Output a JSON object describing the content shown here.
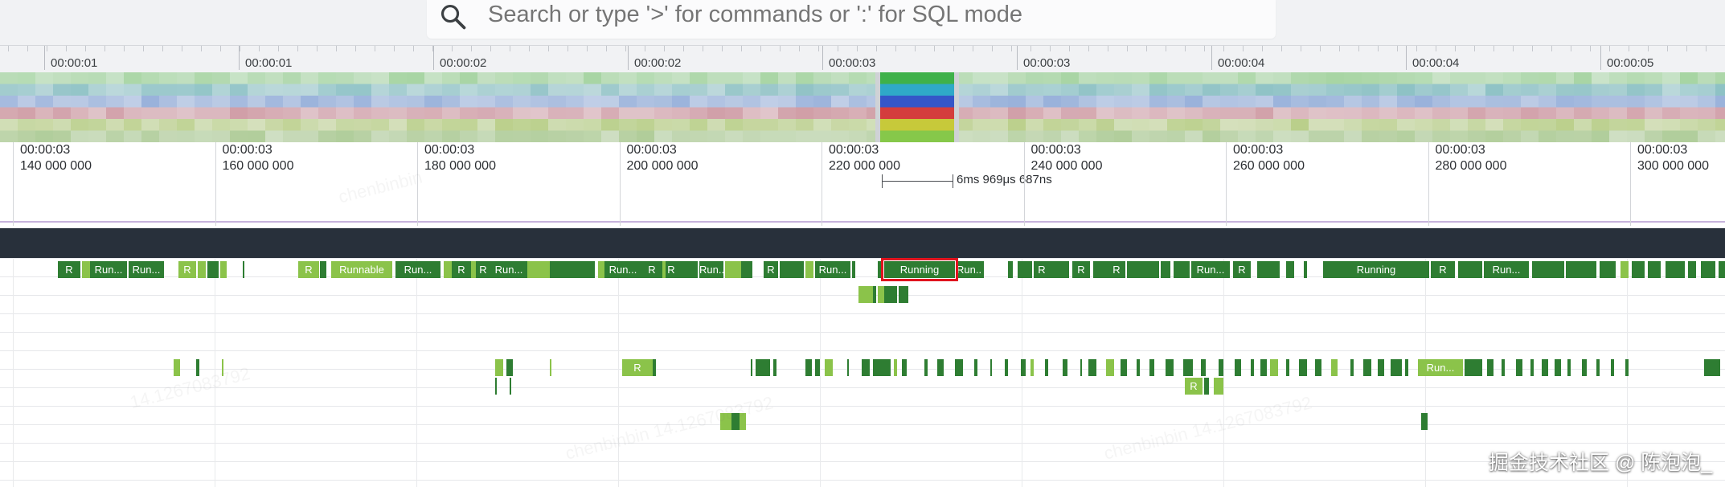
{
  "search": {
    "placeholder": "Search or type '>' for commands or ':' for SQL mode",
    "icon": "search-icon"
  },
  "top_ruler": {
    "labels": [
      "00:00:01",
      "00:00:01",
      "00:00:02",
      "00:00:02",
      "00:00:03",
      "00:00:03",
      "00:00:04",
      "00:00:04",
      "00:00:05"
    ]
  },
  "detail_axis": {
    "labels": [
      {
        "time": "00:00:03",
        "ns": "140 000 000"
      },
      {
        "time": "00:00:03",
        "ns": "160 000 000"
      },
      {
        "time": "00:00:03",
        "ns": "180 000 000"
      },
      {
        "time": "00:00:03",
        "ns": "200 000 000"
      },
      {
        "time": "00:00:03",
        "ns": "220 000 000"
      },
      {
        "time": "00:00:03",
        "ns": "240 000 000"
      },
      {
        "time": "00:00:03",
        "ns": "260 000 000"
      },
      {
        "time": "00:00:03",
        "ns": "280 000 000"
      },
      {
        "time": "00:00:03",
        "ns": "300 000 000"
      }
    ],
    "measurement": "6ms 969μs 687ns"
  },
  "colors": {
    "running": "#2e7d32",
    "runnable": "#8bc34a",
    "highlight": "#e0141e",
    "header_band": "#28303b"
  },
  "slice_states": {
    "running": "Running",
    "running_short": "Run...",
    "runnable": "Runnable",
    "runnable_short": "R"
  },
  "selected_slice": "Running",
  "watermark": {
    "text_1": "chenbinbin",
    "text_2": "14.1267083792",
    "text_3": "chenbinbin 14.1267083792"
  },
  "brand": "掘金技术社区 @ 陈泡泡_"
}
